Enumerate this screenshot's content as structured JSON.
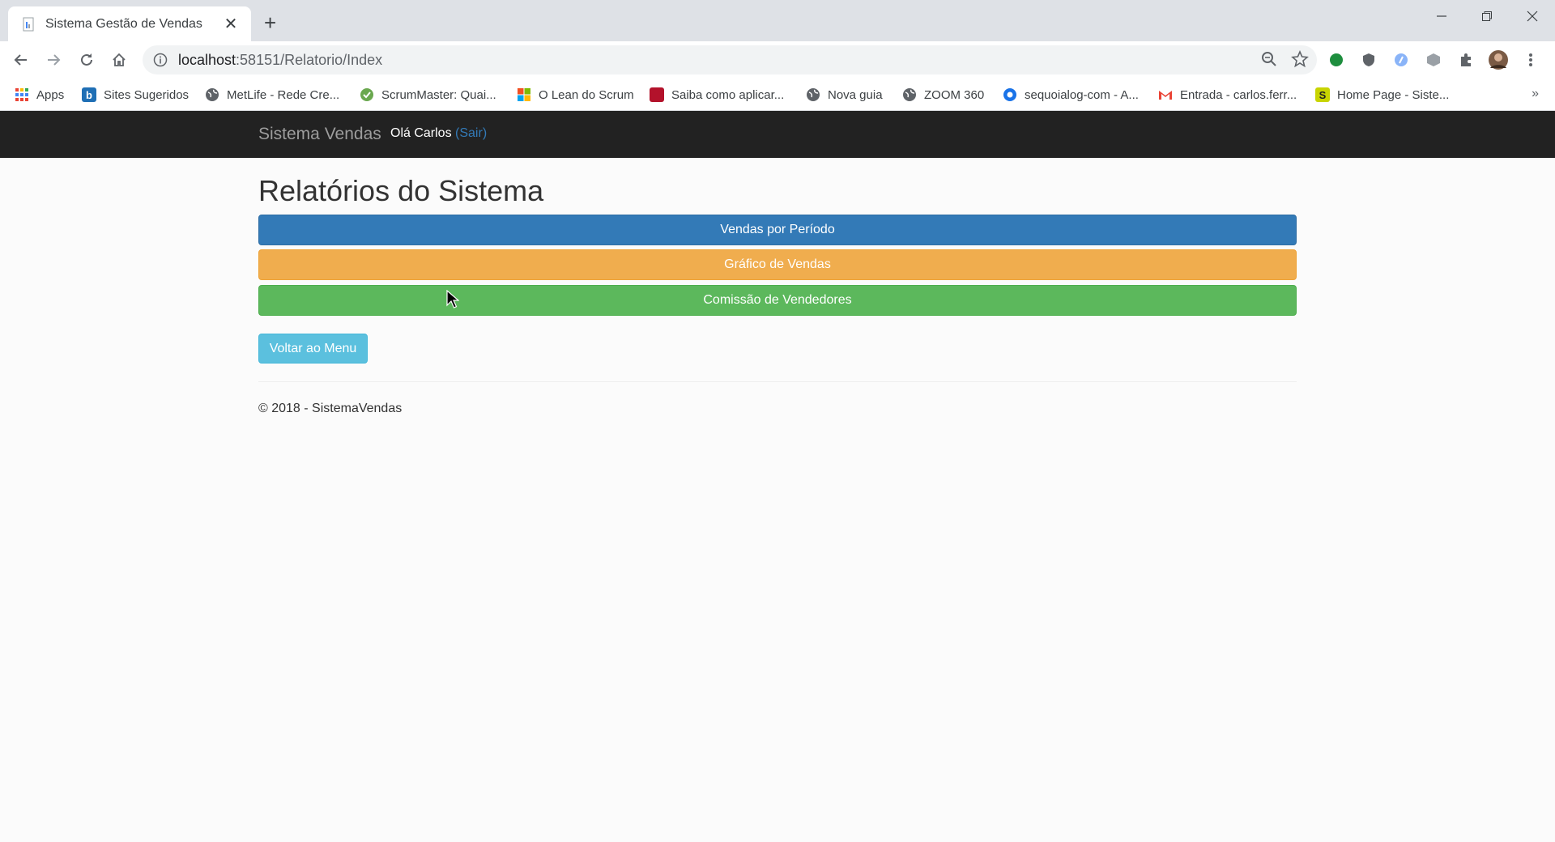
{
  "browser": {
    "tab_title": "Sistema Gestão de Vendas",
    "new_tab": "+",
    "close_tab": "✕",
    "url_host": "localhost",
    "url_path": ":58151/Relatorio/Index",
    "bookmarks": [
      {
        "label": "Apps",
        "icon": "apps-grid-icon",
        "color": "#ea4335"
      },
      {
        "label": "Sites Sugeridos",
        "icon": "bing-icon",
        "color": "#1f6fb5"
      },
      {
        "label": "MetLife - Rede Cre...",
        "icon": "globe-icon",
        "color": "#5f6368"
      },
      {
        "label": "ScrumMaster: Quai...",
        "icon": "scrum-icon",
        "color": "#6aa84f"
      },
      {
        "label": "O Lean do Scrum",
        "icon": "microsoft-icon",
        "color": "#f25022"
      },
      {
        "label": "Saiba como aplicar...",
        "icon": "red-book-icon",
        "color": "#b3122b"
      },
      {
        "label": "Nova guia",
        "icon": "globe-icon",
        "color": "#5f6368"
      },
      {
        "label": "ZOOM 360",
        "icon": "globe-icon",
        "color": "#5f6368"
      },
      {
        "label": "sequoialog-com - A...",
        "icon": "circle-o-icon",
        "color": "#1a73e8"
      },
      {
        "label": "Entrada - carlos.ferr...",
        "icon": "gmail-icon",
        "color": "#ea4335"
      },
      {
        "label": "Home Page - Siste...",
        "icon": "s-logo-icon",
        "color": "#c8d400"
      }
    ],
    "bookmarks_more": "»"
  },
  "navbar": {
    "brand": "Sistema Vendas",
    "greeting": "Olá Carlos",
    "logout": "(Sair)"
  },
  "main": {
    "title": "Relatórios do Sistema",
    "buttons": {
      "vendas_periodo": "Vendas por Período",
      "grafico_vendas": "Gráfico de Vendas",
      "comissao": "Comissão de Vendedores",
      "voltar": "Voltar ao Menu"
    }
  },
  "footer": {
    "text": "© 2018 - SistemaVendas"
  },
  "colors": {
    "primary": "#337ab7",
    "warning": "#f0ad4e",
    "success": "#5cb85c",
    "info": "#5bc0de",
    "navbar": "#222222"
  }
}
